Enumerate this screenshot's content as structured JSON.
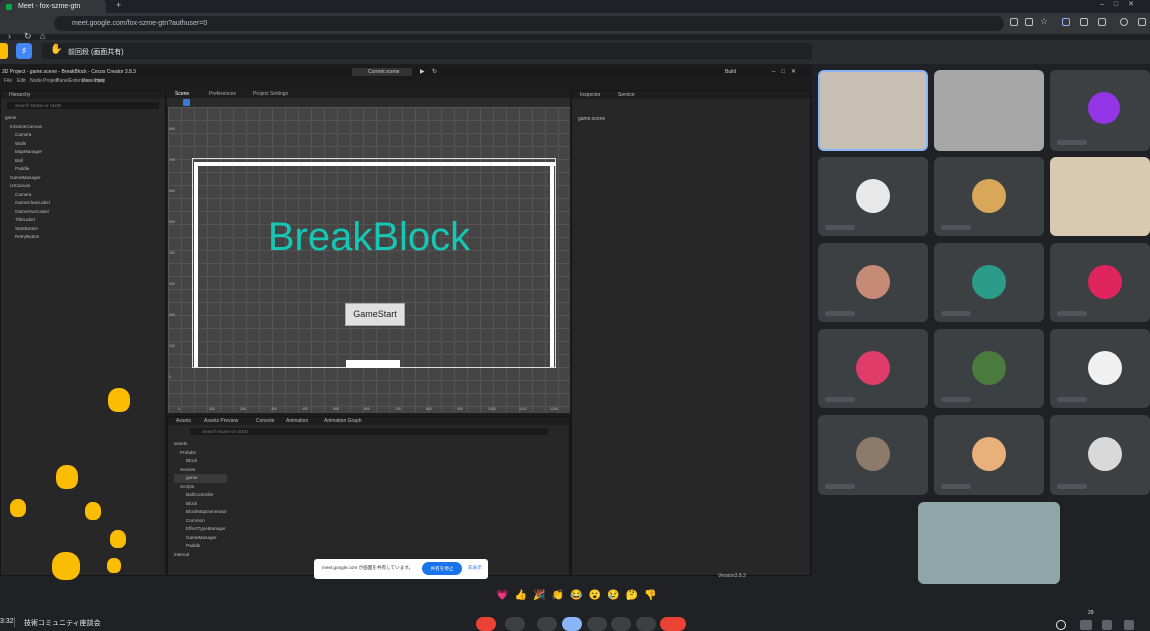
{
  "browser": {
    "tab_title": "Meet - fox-szme-gtn",
    "url": "meet.google.com/fox-szme-gtn?authuser=0"
  },
  "meet": {
    "presenter_label": "前回段 (画面共有)",
    "meeting_name": "技術コミュニティ座談会",
    "time": "3:32",
    "participants_badge": "29"
  },
  "cocos": {
    "window_title": "3D Project - game.scene - BreakBlock - Cocos Creator 3.8.3",
    "menus": [
      "File",
      "Edit",
      "Node",
      "Project",
      "Panel",
      "Extension",
      "Developer",
      "Help"
    ],
    "scene_dropdown": "Current scene",
    "build_label": "Build",
    "hierarchy": {
      "title": "Hierarchy",
      "search_placeholder": "Search Name or UUID",
      "nodes": [
        "game",
        "InGameCanvas",
        "Camera",
        "Walls",
        "MapManager",
        "Ball",
        "Paddle",
        "GameManager",
        "UICanvas",
        "Camera",
        "GameClearLabel",
        "GameOverLabel",
        "TitleLabel",
        "StartButton",
        "RetryButton"
      ]
    },
    "scene_tabs": [
      "Scene",
      "Preferences",
      "Project Settings"
    ],
    "game": {
      "title": "BreakBlock",
      "start_button": "GameStart"
    },
    "y_ticks": [
      "800",
      "700",
      "600",
      "500",
      "400",
      "300",
      "200",
      "100",
      "0"
    ],
    "x_ticks": [
      "0",
      "100",
      "200",
      "300",
      "400",
      "500",
      "600",
      "700",
      "800",
      "900",
      "1000",
      "1100",
      "1200"
    ],
    "inspector": {
      "tabs": [
        "Inspector",
        "Service"
      ],
      "item": "game.scene"
    },
    "assets": {
      "tabs": [
        "Assets",
        "Assets Preview",
        "Console",
        "Animation",
        "Animation Graph"
      ],
      "search_placeholder": "Search Name or UUID",
      "items": [
        "assets",
        "Prefabs",
        "Block",
        "Scenes",
        "game",
        "Scripts",
        "BallController",
        "Block",
        "BlockMapGenerator",
        "Common",
        "EffectTypeManager",
        "GameManager",
        "Paddle",
        "internal"
      ]
    },
    "status": {
      "version": "Version3.8.3"
    },
    "share_bar": {
      "text": "meet.google.com が画面を共有しています。",
      "stop_button": "共有を停止",
      "hide_button": "非表示"
    }
  },
  "reactions": [
    "💗",
    "👍",
    "🎉",
    "👏",
    "😂",
    "😮",
    "😢",
    "🤔",
    "👎"
  ],
  "colors": {
    "title": "#16c7b4",
    "accent": "#8ab4f8",
    "end_call": "#ea4335"
  }
}
